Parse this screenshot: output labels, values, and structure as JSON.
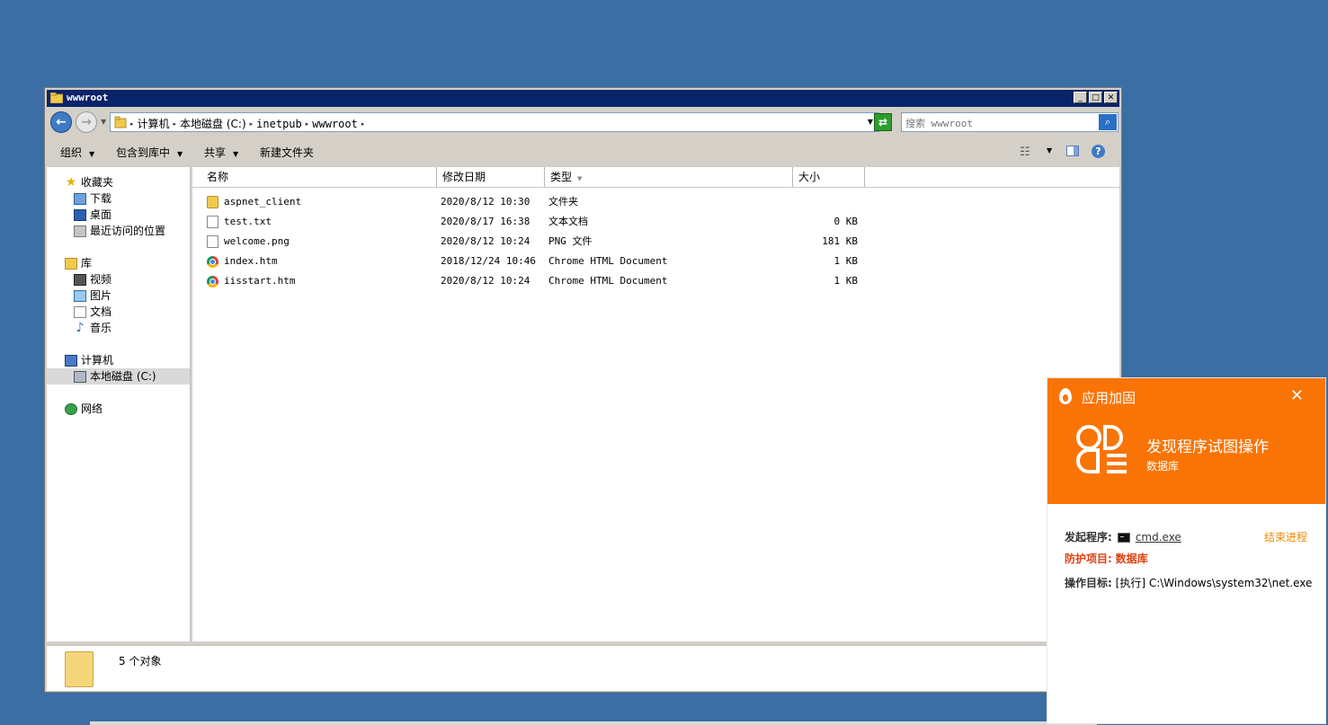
{
  "window": {
    "title": "wwwroot",
    "caption_buttons": {
      "minimize": "_",
      "maximize": "□",
      "close": "✕"
    }
  },
  "address": {
    "breadcrumbs": [
      "计算机",
      "本地磁盘 (C:)",
      "inetpub",
      "wwwroot"
    ]
  },
  "search": {
    "placeholder": "搜索 wwwroot",
    "value": ""
  },
  "toolbar": {
    "organize": "组织",
    "include_library": "包含到库中",
    "share": "共享",
    "new_folder": "新建文件夹"
  },
  "nav": {
    "favorites": "收藏夹",
    "downloads": "下载",
    "desktop": "桌面",
    "recent": "最近访问的位置",
    "libraries": "库",
    "videos": "视频",
    "pictures": "图片",
    "documents": "文档",
    "music": "音乐",
    "computer": "计算机",
    "local_disk": "本地磁盘 (C:)",
    "network": "网络"
  },
  "columns": {
    "name": "名称",
    "modified": "修改日期",
    "type": "类型",
    "size": "大小"
  },
  "files": [
    {
      "name": "aspnet_client",
      "modified": "2020/8/12 10:30",
      "type": "文件夹",
      "size": "",
      "icon": "folder-icon"
    },
    {
      "name": "test.txt",
      "modified": "2020/8/17 16:38",
      "type": "文本文档",
      "size": "0 KB",
      "icon": "text-file-icon"
    },
    {
      "name": "welcome.png",
      "modified": "2020/8/12 10:24",
      "type": "PNG 文件",
      "size": "181 KB",
      "icon": "image-file-icon"
    },
    {
      "name": "index.htm",
      "modified": "2018/12/24 10:46",
      "type": "Chrome HTML Document",
      "size": "1 KB",
      "icon": "chrome-icon"
    },
    {
      "name": "iisstart.htm",
      "modified": "2020/8/12 10:24",
      "type": "Chrome HTML Document",
      "size": "1 KB",
      "icon": "chrome-icon"
    }
  ],
  "status": {
    "count_text": "5 个对象"
  },
  "popup": {
    "title": "应用加固",
    "close": "✕",
    "headline": "发现程序试图操作",
    "subheadline": "数据库",
    "initiator_label": "发起程序:",
    "initiator_value": "cmd.exe",
    "kill_label": "结束进程",
    "protect_label": "防护项目:",
    "protect_value": "数据库",
    "target_label": "操作目标:",
    "target_value": "[执行] C:\\Windows\\system32\\net.exe",
    "accent_color": "#fa7405"
  }
}
